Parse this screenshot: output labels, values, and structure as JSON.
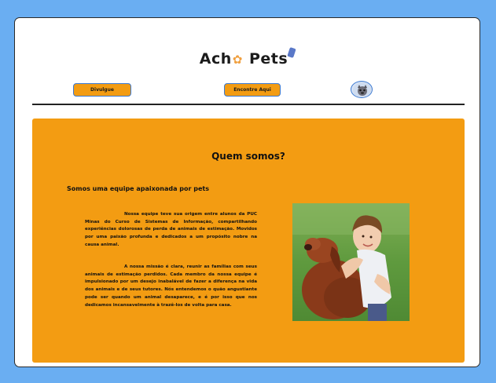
{
  "header": {
    "logo_text_left": "Ach",
    "logo_text_right": "Pets"
  },
  "nav": {
    "divulgue_label": "Divulgue",
    "encontre_label": "Encontre Aqui"
  },
  "about": {
    "title": "Quem somos?",
    "subtitle": "Somos uma equipe apaixonada por pets",
    "paragraph1": "Nossa equipe teve sua origem entre alunos da PUC Minas do Curso de Sistemas de Informação, compartilhando experiências dolorosas de perda de animais de estimação. Movidos por uma paixão profunda e dedicados a um propósito nobre na causa animal.",
    "paragraph2": "A nossa missão é clara, reunir as famílias com seus animais de estimação perdidos. Cada membro da nossa equipe é impulsionado por um desejo inabalável de fazer a diferença na vida dos animais e de seus tutores. Nós entendemos o quão angustiante pode ser quando um animal desaparece, e é por isso que nos dedicamos incansavelmente à trazê-los de volta para casa."
  },
  "colors": {
    "background": "#6aaef2",
    "accent": "#f39c12",
    "button_border": "#3a78d0"
  },
  "icons": {
    "logo_paw": "paw-icon",
    "avatar": "user-avatar-icon"
  }
}
